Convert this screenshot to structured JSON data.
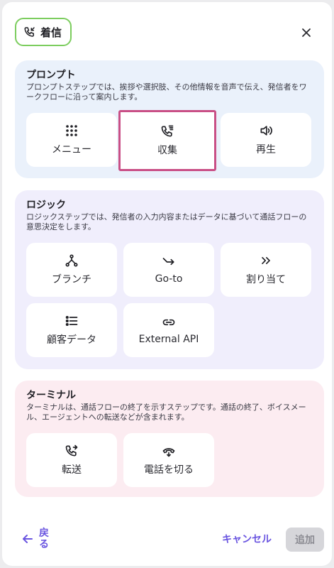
{
  "header": {
    "chip_label": "着信",
    "chip_icon": "phone-incoming-icon",
    "close_icon": "close-icon"
  },
  "sections": {
    "prompt": {
      "title": "プロンプト",
      "description": "プロンプトステップでは、挨拶や選択肢、その他情報を音声で伝え、発信者をワークフローに沿って案内します。",
      "items": [
        {
          "label": "メニュー",
          "icon": "grid-dots-icon"
        },
        {
          "label": "収集",
          "icon": "phone-collect-icon",
          "selected": true
        },
        {
          "label": "再生",
          "icon": "speaker-icon"
        }
      ]
    },
    "logic": {
      "title": "ロジック",
      "description": "ロジックステップでは、発信者の入力内容またはデータに基づいて通話フローの意思決定をします。",
      "items": [
        {
          "label": "ブランチ",
          "icon": "branch-icon"
        },
        {
          "label": "Go-to",
          "icon": "goto-arrow-icon"
        },
        {
          "label": "割り当て",
          "icon": "double-chevron-right-icon"
        },
        {
          "label": "顧客データ",
          "icon": "list-icon"
        },
        {
          "label": "External API",
          "icon": "link-icon"
        }
      ]
    },
    "terminal": {
      "title": "ターミナル",
      "description": "ターミナルは、通話フローの終了を示すステップです。通話の終了、ボイスメール、エージェントへの転送などが含まれます。",
      "items": [
        {
          "label": "転送",
          "icon": "phone-transfer-icon"
        },
        {
          "label": "電話を切る",
          "icon": "hang-up-icon"
        }
      ]
    }
  },
  "footer": {
    "back_label": "戻る",
    "cancel_label": "キャンセル",
    "add_label": "追加"
  },
  "colors": {
    "accent": "#6a55e0",
    "chip_border": "#7ccd5e",
    "selected_border": "#c94f86"
  }
}
